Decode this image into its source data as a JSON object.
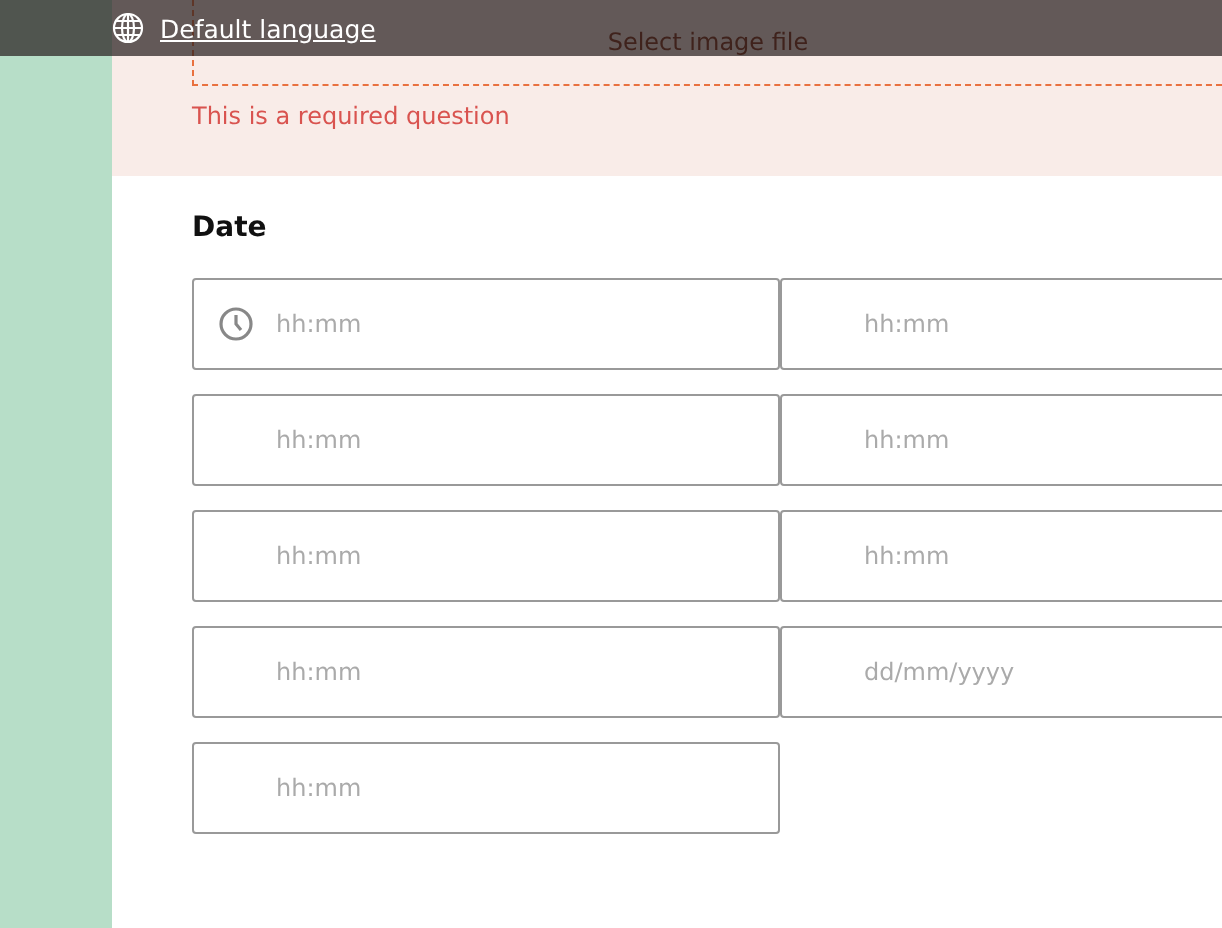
{
  "top_bar": {
    "language_link": "Default language"
  },
  "upload": {
    "label": "Select image file",
    "error": "This is a required question"
  },
  "date_question": {
    "title": "Date",
    "fields": [
      {
        "placeholder": "hh:mm",
        "clock_icon": true
      },
      {
        "placeholder": "hh:mm",
        "clock_icon": false
      },
      {
        "placeholder": "hh:mm",
        "clock_icon": false
      },
      {
        "placeholder": "hh:mm",
        "clock_icon": false
      },
      {
        "placeholder": "hh:mm",
        "clock_icon": false
      },
      {
        "placeholder": "hh:mm",
        "clock_icon": false
      },
      {
        "placeholder": "hh:mm",
        "clock_icon": false
      },
      {
        "placeholder": "dd/mm/yyyy",
        "clock_icon": false
      },
      {
        "placeholder": "hh:mm",
        "clock_icon": false
      }
    ]
  }
}
